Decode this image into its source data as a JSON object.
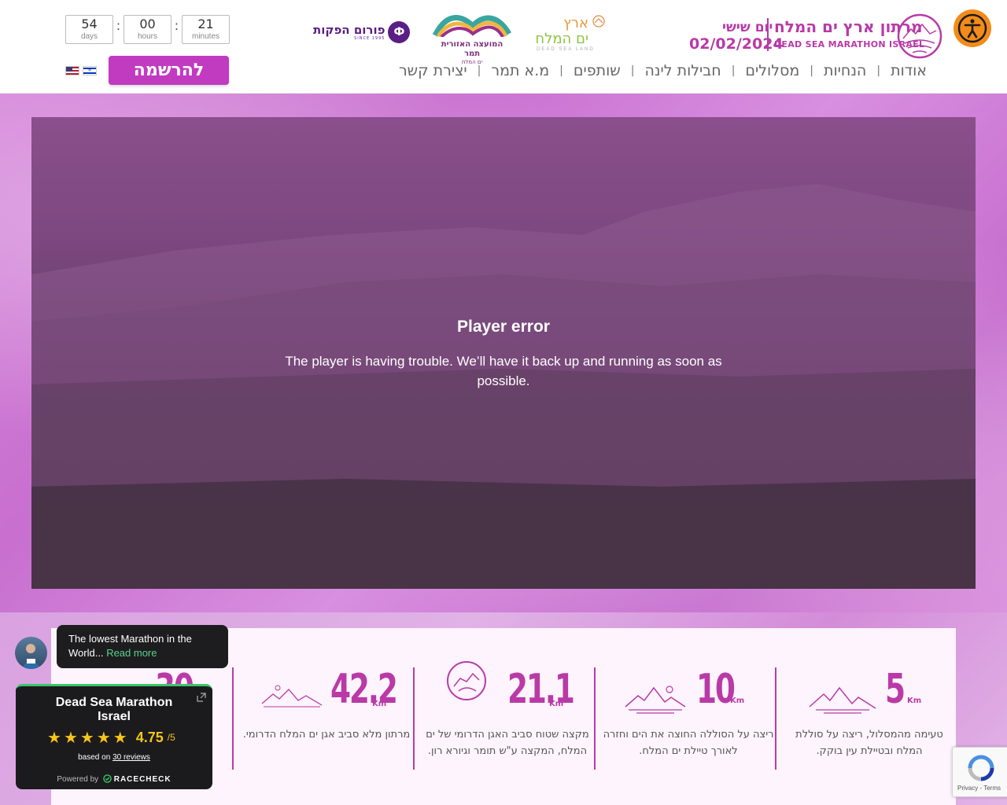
{
  "countdown": {
    "days_value": "54",
    "days_label": "days",
    "hours_value": "00",
    "hours_label": "hours",
    "minutes_value": "21",
    "minutes_label": "minutes",
    "separator": ":"
  },
  "languages": [
    "en",
    "he"
  ],
  "register_button": "להרשמה",
  "logos": {
    "forum": {
      "name": "פורום הפקות",
      "tagline": "SINCE 1995",
      "mark": "Ф"
    },
    "council": {
      "line1": "המועצה האזורית תמר",
      "line2": "ים המלח"
    },
    "dead_sea_land": {
      "line1": "ארץ",
      "line2": "ים המלח",
      "line3": "DEAD SEA LAND"
    },
    "marathon": {
      "day": "יום שישי",
      "date": "02/02/2024",
      "name_he": "מרתון ארץ ים המלח",
      "name_en": "DEAD SEA MARATHON ISRAEL"
    }
  },
  "accessibility": {
    "icon": "accessibility-icon"
  },
  "nav": {
    "separator": "|",
    "items": [
      "אודות",
      "הנחיות",
      "מסלולים",
      "חבילות לינה",
      "שותפים",
      "מ.א תמר",
      "יצירת קשר"
    ]
  },
  "player": {
    "title": "Player error",
    "message": "The player is having trouble. We’ll have it back up and running as soon as possible."
  },
  "distances": [
    {
      "value": "5",
      "unit": "Km",
      "description": "טעימה מהמסלול, ריצה על סוללת המלח ובטיילת עין בוקק."
    },
    {
      "value": "10",
      "unit": "Km",
      "description": "ריצה על הסוללה החוצה את הים וחזרה לאורך טיילת ים המלח."
    },
    {
      "value": "21.1",
      "unit": "Km",
      "description": "מקצה שטוח סביב האגן הדרומי של ים המלח, המקצה ע\"ש תומר וגיורא רון."
    },
    {
      "value": "42.2",
      "unit": "Km",
      "description": "מרתון מלא סביב אגן ים המלח הדרומי."
    },
    {
      "value": "30",
      "unit": "Km",
      "description": ""
    }
  ],
  "tooltip": {
    "text": "The lowest Marathon in the World...",
    "link": "Read more"
  },
  "racecheck": {
    "title": "Dead Sea Marathon Israel",
    "score": "4.75",
    "max": "/5",
    "based_on": "based on",
    "reviews": "30 reviews",
    "powered_by": "Powered by",
    "brand": "RACECHECK"
  },
  "recaptcha": {
    "privacy": "Privacy",
    "terms": "Terms",
    "sep": " - "
  },
  "colors": {
    "brand": "#b93aa7",
    "register": "#c13bc0",
    "accessibility": "#f28b18",
    "rating": "#f5c518",
    "racecheck_green": "#3cc56a"
  }
}
